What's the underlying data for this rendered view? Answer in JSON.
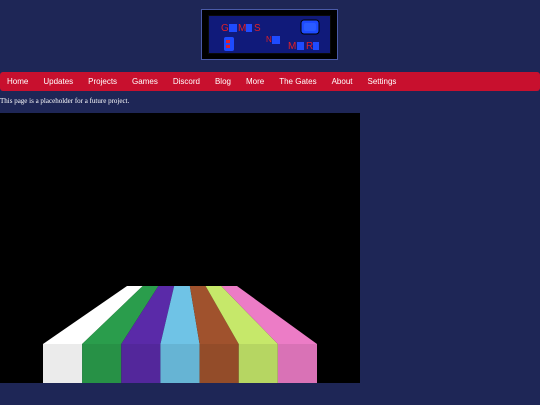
{
  "logo": {
    "letters": [
      "G",
      "M",
      "S",
      "N",
      "M",
      "R"
    ],
    "colors": {
      "red": "#e0202a",
      "blue": "#1e4bff",
      "panel": "#101a7a",
      "frame": "#000000"
    }
  },
  "nav": {
    "items": [
      {
        "label": "Home"
      },
      {
        "label": "Updates"
      },
      {
        "label": "Projects"
      },
      {
        "label": "Games"
      },
      {
        "label": "Discord"
      },
      {
        "label": "Blog"
      },
      {
        "label": "More"
      },
      {
        "label": "The Gates"
      },
      {
        "label": "About"
      },
      {
        "label": "Settings"
      }
    ]
  },
  "main": {
    "placeholder": "This page is a placeholder for a future project."
  },
  "scene": {
    "background": "#000000",
    "stripe_colors": [
      "#ffffff",
      "#2a9d4c",
      "#5a2aa8",
      "#6fc3e6",
      "#a0522d",
      "#c6e86a",
      "#ec7cc6"
    ]
  },
  "theme": {
    "page_bg": "#1e2656",
    "nav_bg": "#c8102e",
    "text": "#ffffff"
  }
}
